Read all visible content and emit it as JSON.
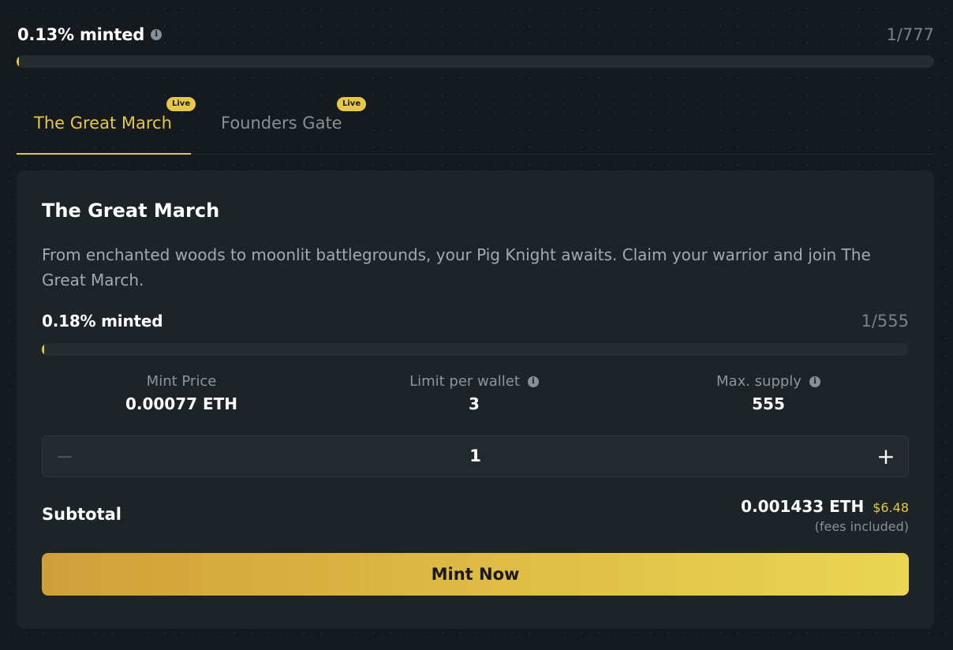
{
  "overall": {
    "minted_label": "0.13% minted",
    "count": "1/777",
    "progress_fraction": 0.0013
  },
  "tabs": [
    {
      "label": "The Great March",
      "badge": "Live",
      "active": true
    },
    {
      "label": "Founders Gate",
      "badge": "Live",
      "active": false
    }
  ],
  "card": {
    "title": "The Great March",
    "description": "From enchanted woods to moonlit battlegrounds, your Pig Knight awaits. Claim your warrior and join The Great March.",
    "minted_label": "0.18% minted",
    "count": "1/555",
    "progress_fraction": 0.0018,
    "stats": {
      "price_label": "Mint Price",
      "price_value": "0.00077 ETH",
      "limit_label": "Limit per wallet",
      "limit_value": "3",
      "supply_label": "Max. supply",
      "supply_value": "555"
    },
    "quantity": "1",
    "subtotal_label": "Subtotal",
    "subtotal_eth": "0.001433 ETH",
    "subtotal_usd": "$6.48",
    "fees_note": "(fees included)",
    "mint_button": "Mint Now"
  },
  "colors": {
    "accent": "#e5c84a",
    "background": "#141a1d",
    "card": "#1d2427"
  },
  "icons": {
    "info": "info-icon",
    "minus": "minus-icon",
    "plus": "plus-icon"
  }
}
